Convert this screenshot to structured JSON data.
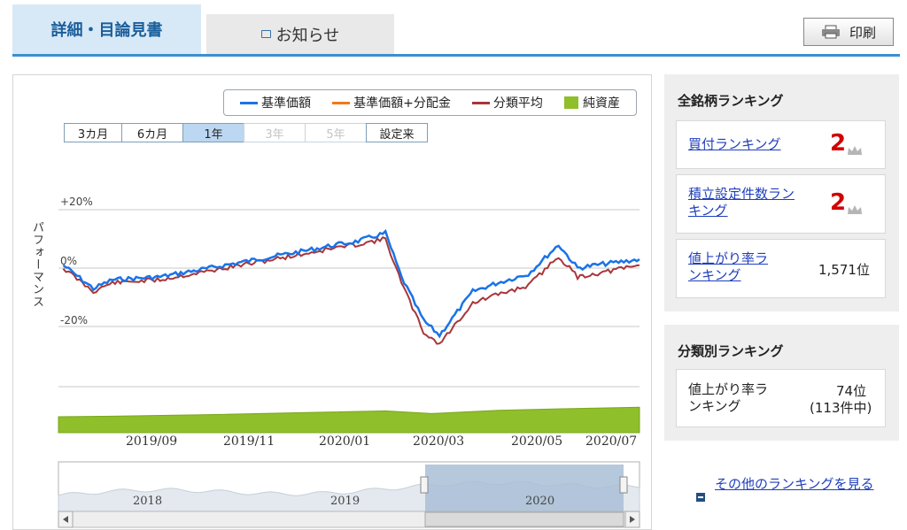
{
  "tabs": {
    "details": "詳細・目論見書",
    "news": "お知らせ"
  },
  "print_label": "印刷",
  "legend": [
    {
      "label": "基準価額",
      "color": "#1a73e8"
    },
    {
      "label": "基準価額+分配金",
      "color": "#f07a1a"
    },
    {
      "label": "分類平均",
      "color": "#a8363a"
    },
    {
      "label": "純資産",
      "color": "#8fbf2a"
    }
  ],
  "periods": [
    {
      "label": "3カ月",
      "state": "normal"
    },
    {
      "label": "6カ月",
      "state": "normal"
    },
    {
      "label": "1年",
      "state": "selected"
    },
    {
      "label": "3年",
      "state": "disabled"
    },
    {
      "label": "5年",
      "state": "disabled"
    },
    {
      "label": "設定来",
      "state": "normal"
    }
  ],
  "chart_data": {
    "type": "line",
    "ylabel": "パフォーマンス",
    "yticks": [
      "+20%",
      "0%",
      "-20%"
    ],
    "ylim": [
      -30,
      25
    ],
    "x_ticks": [
      "2019/09",
      "2019/11",
      "2020/01",
      "2020/03",
      "2020/05",
      "2020/07"
    ],
    "x_range": [
      "2019/07/29",
      "2020/07/29"
    ],
    "series": [
      {
        "name": "基準価額",
        "color": "#1a73e8",
        "x": [
          "2019/08/01",
          "2019/08/20",
          "2019/09/01",
          "2019/10/01",
          "2019/11/01",
          "2019/12/01",
          "2020/01/01",
          "2020/01/20",
          "2020/02/01",
          "2020/02/20",
          "2020/03/01",
          "2020/03/15",
          "2020/03/25",
          "2020/04/15",
          "2020/05/01",
          "2020/05/20",
          "2020/06/08",
          "2020/06/20",
          "2020/07/01",
          "2020/07/29"
        ],
        "values": [
          1,
          -7,
          -4,
          -3,
          0,
          3,
          6,
          8,
          9,
          12,
          -3,
          -18,
          -23,
          -8,
          -5,
          -2,
          8,
          0,
          1,
          3
        ]
      },
      {
        "name": "分類平均",
        "color": "#a8363a",
        "x": [
          "2019/08/01",
          "2019/08/20",
          "2019/09/01",
          "2019/10/01",
          "2019/11/01",
          "2019/12/01",
          "2020/01/01",
          "2020/01/20",
          "2020/02/01",
          "2020/02/20",
          "2020/03/01",
          "2020/03/15",
          "2020/03/25",
          "2020/04/15",
          "2020/05/01",
          "2020/05/20",
          "2020/06/08",
          "2020/06/20",
          "2020/07/01",
          "2020/07/29"
        ],
        "values": [
          0,
          -8,
          -5,
          -4,
          -1,
          2,
          5,
          7,
          8,
          10,
          -5,
          -22,
          -26,
          -12,
          -9,
          -6,
          4,
          -3,
          -2,
          1
        ]
      },
      {
        "name": "純資産",
        "color": "#8fbf2a",
        "x": [
          "2019/07/29",
          "2019/09/01",
          "2019/11/01",
          "2020/01/01",
          "2020/02/20",
          "2020/03/20",
          "2020/05/01",
          "2020/06/10",
          "2020/07/29"
        ],
        "values": [
          100,
          101,
          104,
          108,
          111,
          106,
          112,
          115,
          118
        ]
      }
    ],
    "navigator_ticks": [
      "2018",
      "2019",
      "2020"
    ]
  },
  "ranking_all": {
    "title": "全銘柄ランキング",
    "items": [
      {
        "label": "買付ランキング",
        "value": "2",
        "icon": "crown-icon"
      },
      {
        "label": "積立設定件数ランキング",
        "value": "2",
        "icon": "crown-icon"
      },
      {
        "label": "値上がり率ランキング",
        "value": "1,571位"
      }
    ]
  },
  "ranking_class": {
    "title": "分類別ランキング",
    "label": "値上がり率ランキング",
    "rank": "74位",
    "count": "(113件中)"
  },
  "more_link": "その他のランキングを見る"
}
